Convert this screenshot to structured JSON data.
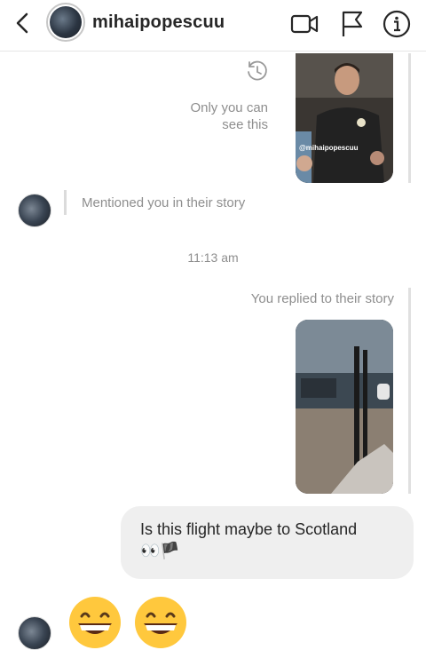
{
  "header": {
    "username": "mihaipopescuu",
    "icons": [
      "back-icon",
      "video-icon",
      "flag-icon",
      "info-icon"
    ]
  },
  "messages": {
    "top_story_handle": "@mihaipopescuu",
    "only_you_line1": "Only you can",
    "only_you_line2": "see this",
    "mention_text": "Mentioned you in their story",
    "timestamp": "11:13 am",
    "replied_label": "You replied to their story",
    "bubble_text": "Is this flight maybe to Scotland",
    "bubble_emojis": "👀🏴",
    "emoji_reply": "😁😁"
  },
  "colors": {
    "secondary_text": "#8e8e8e",
    "bubble_bg": "#efefef"
  }
}
